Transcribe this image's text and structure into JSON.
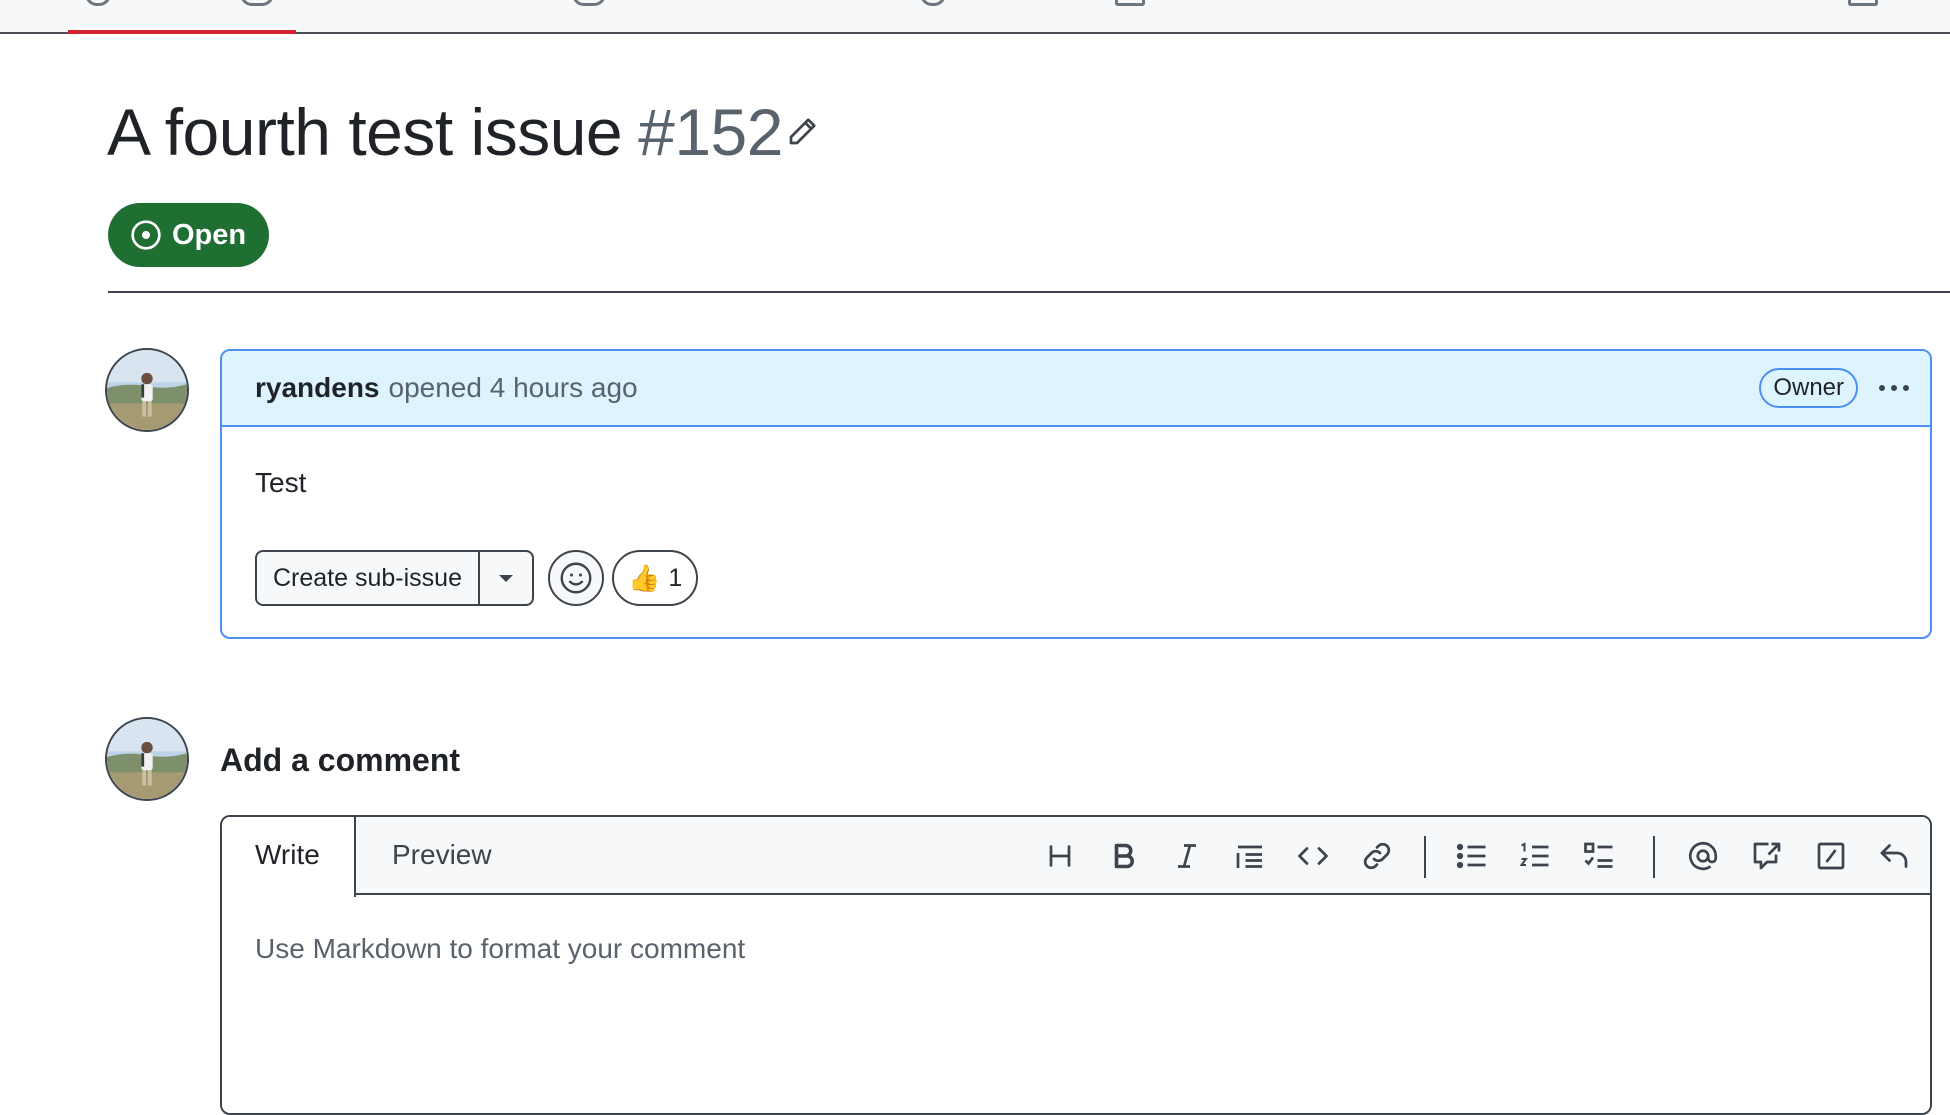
{
  "issue": {
    "title": "A fourth test issue",
    "number": "#152",
    "state": "Open"
  },
  "comment": {
    "author": "ryandens",
    "meta": "opened 4 hours ago",
    "role_badge": "Owner",
    "body": "Test",
    "create_sub_issue_label": "Create sub-issue",
    "reaction_emoji": "👍",
    "reaction_count": "1"
  },
  "add_comment": {
    "heading": "Add a comment",
    "tabs": [
      "Write",
      "Preview"
    ],
    "placeholder": "Use Markdown to format your comment",
    "toolbar_icons": [
      "heading-icon",
      "bold-icon",
      "italic-icon",
      "quote-icon",
      "code-icon",
      "link-icon",
      "unordered-list-icon",
      "ordered-list-icon",
      "task-list-icon",
      "mention-icon",
      "cross-reference-icon",
      "slash-commands-icon",
      "undo-icon"
    ]
  },
  "colors": {
    "open_green": "#1f6f33",
    "accent_blue": "#4c8ff3",
    "header_blue": "#ddf4ff",
    "active_tab_red": "#d1242f"
  }
}
